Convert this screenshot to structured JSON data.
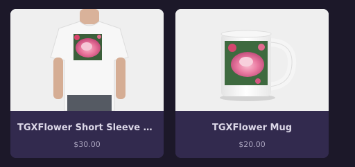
{
  "products": [
    {
      "name": "TGXFlower Short Sleeve T-S...",
      "price": "$30.00",
      "image_icon": "tshirt-product-image"
    },
    {
      "name": "TGXFlower Mug",
      "price": "$20.00",
      "image_icon": "mug-product-image"
    }
  ],
  "colors": {
    "page_background": "#1c1829",
    "card_info_background": "#322a4e",
    "product_name_text": "#dcd8e8",
    "price_text": "#a9a3bd",
    "image_background": "#f0f0f0"
  }
}
